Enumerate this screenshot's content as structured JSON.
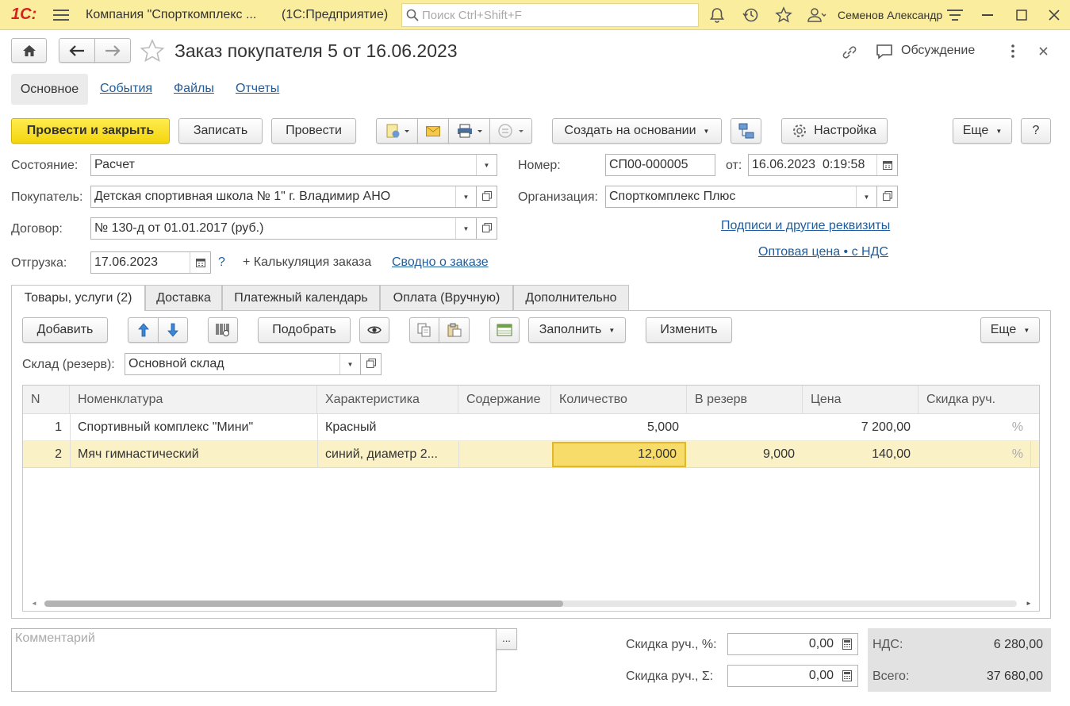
{
  "app": {
    "logo": "1С:",
    "title": "Компания \"Спорткомплекс ...",
    "platform": "(1С:Предприятие)",
    "search_placeholder": "Поиск Ctrl+Shift+F",
    "user": "Семенов Александр"
  },
  "doc": {
    "title": "Заказ покупателя 5 от 16.06.2023",
    "discussion": "Обсуждение"
  },
  "nav_tabs": [
    "Основное",
    "События",
    "Файлы",
    "Отчеты"
  ],
  "toolbar": {
    "post_close": "Провести и закрыть",
    "save": "Записать",
    "post": "Провести",
    "create_basis": "Создать на основании",
    "settings": "Настройка",
    "more": "Еще",
    "help": "?"
  },
  "form": {
    "state_label": "Состояние:",
    "state_value": "Расчет",
    "buyer_label": "Покупатель:",
    "buyer_value": "Детская спортивная школа  № 1\" г. Владимир АНО",
    "contract_label": "Договор:",
    "contract_value": "№ 130-д от 01.01.2017 (руб.)",
    "ship_label": "Отгрузка:",
    "ship_value": "17.06.2023",
    "help_q": "?",
    "calc_link": "+ Калькуляция заказа",
    "summary_link": "Сводно о заказе",
    "number_label": "Номер:",
    "number_value": "СП00-000005",
    "date_label": "от:",
    "date_value": "16.06.2023  0:19:58",
    "org_label": "Организация:",
    "org_value": "Спорткомплекс Плюс",
    "signatures_link": "Подписи и другие реквизиты",
    "price_link": "Оптовая цена • с НДС"
  },
  "tabs": [
    "Товары, услуги (2)",
    "Доставка",
    "Платежный календарь",
    "Оплата (Вручную)",
    "Дополнительно"
  ],
  "table_toolbar": {
    "add": "Добавить",
    "pick": "Подобрать",
    "fill": "Заполнить",
    "change": "Изменить",
    "more": "Еще"
  },
  "warehouse": {
    "label": "Склад (резерв):",
    "value": "Основной склад"
  },
  "table": {
    "columns": [
      "N",
      "Номенклатура",
      "Характеристика",
      "Содержание",
      "Количество",
      "В резерв",
      "Цена",
      "Скидка руч."
    ],
    "rows": [
      {
        "n": "1",
        "item": "Спортивный комплекс \"Мини\"",
        "char": "Красный",
        "content": "",
        "qty": "5,000",
        "reserve": "",
        "price": "7 200,00",
        "disc": "%"
      },
      {
        "n": "2",
        "item": "Мяч гимнастический",
        "char": "синий, диаметр 2...",
        "content": "",
        "qty": "12,000",
        "reserve": "9,000",
        "price": "140,00",
        "disc": "%"
      }
    ]
  },
  "footer": {
    "comment_placeholder": "Комментарий",
    "ellipsis": "...",
    "disc_pct_label": "Скидка руч., %:",
    "disc_pct_value": "0,00",
    "disc_sum_label": "Скидка руч., Σ:",
    "disc_sum_value": "0,00",
    "vat_label": "НДС:",
    "vat_value": "6 280,00",
    "total_label": "Всего:",
    "total_value": "37 680,00"
  },
  "colors": {
    "topbar": "#fbed9e",
    "primary": "#f4d50e",
    "link": "#1f5d9e",
    "selected_row": "#fbf1c6",
    "active_cell": "#f7dc6a"
  }
}
